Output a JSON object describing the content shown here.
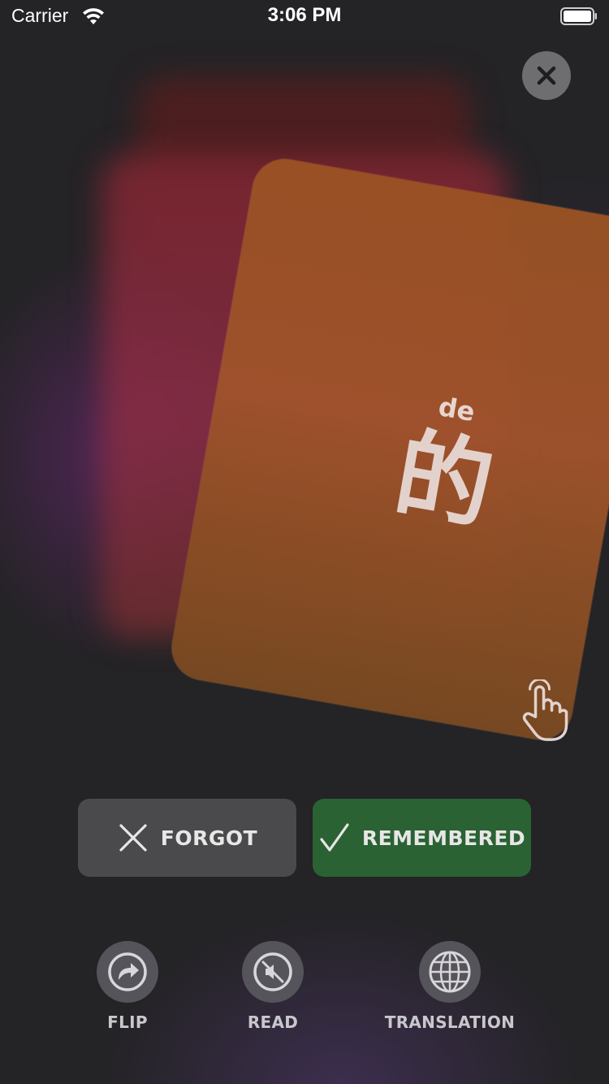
{
  "status_bar": {
    "carrier": "Carrier",
    "time": "3:06 PM"
  },
  "card": {
    "pinyin": "de",
    "character": "的",
    "color": "#9a5224"
  },
  "actions": {
    "forgot_label": "FORGOT",
    "remembered_label": "REMEMBERED",
    "forgot_color": "#4a4a4c",
    "remembered_color": "#2a6234"
  },
  "tools": [
    {
      "label": "FLIP",
      "icon": "flip-icon"
    },
    {
      "label": "READ",
      "icon": "speaker-muted-icon"
    },
    {
      "label": "TRANSLATION",
      "icon": "globe-icon"
    }
  ],
  "icons": {
    "close": "close-icon",
    "tap": "tap-hand-icon",
    "wifi": "wifi-icon",
    "battery": "battery-icon"
  }
}
